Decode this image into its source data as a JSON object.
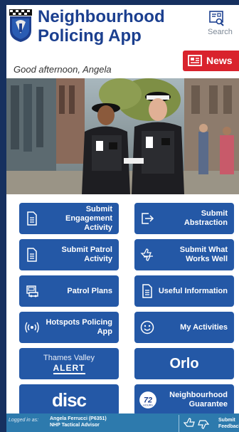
{
  "header": {
    "title_line1": "Neighbourhood",
    "title_line2": "Policing App",
    "search_label": "Search",
    "greeting": "Good afternoon, Angela",
    "news_label": "News"
  },
  "tiles": [
    {
      "label": "Submit Engagement Activity",
      "icon": "document-icon"
    },
    {
      "label": "Submit Abstraction",
      "icon": "exit-arrow-icon"
    },
    {
      "label": "Submit Patrol Activity",
      "icon": "document-icon"
    },
    {
      "label": "Submit What Works Well",
      "icon": "thumbs-icon"
    },
    {
      "label": "Patrol Plans",
      "icon": "car-icon"
    },
    {
      "label": "Useful Information",
      "icon": "document-icon"
    },
    {
      "label": "Hotspots Policing App",
      "icon": "radio-signal-icon"
    },
    {
      "label": "My Activities",
      "icon": "smiley-icon"
    },
    {
      "label": "Thames Valley",
      "label2": "ALERT",
      "icon": "tv-alert-logo"
    },
    {
      "label": "Orlo",
      "icon": "orlo-logo"
    },
    {
      "label": "disc",
      "icon": "disc-logo"
    },
    {
      "label": "Neighbourhood Guarantee",
      "icon": "72-hours-icon"
    }
  ],
  "footer": {
    "logged_in_label": "Logged in as:",
    "user_name": "Angela Ferrucci (P6351)",
    "user_role": "NHP Tactical Advisor",
    "feedback_label_1": "Submit",
    "feedback_label_2": "Feedback"
  },
  "colors": {
    "brand_blue": "#1b3f8f",
    "tile_blue": "#2458a6",
    "news_red": "#d9232d",
    "footer_blue": "#2d7aad"
  }
}
